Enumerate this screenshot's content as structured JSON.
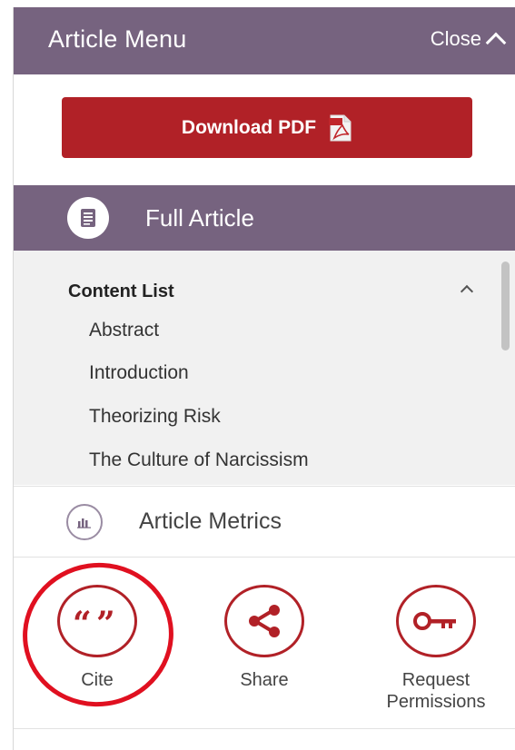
{
  "header": {
    "title": "Article Menu",
    "close_label": "Close"
  },
  "download": {
    "label": "Download PDF",
    "icon": "pdf-file-icon"
  },
  "full_article": {
    "label": "Full Article",
    "icon": "document-icon"
  },
  "content_list": {
    "title": "Content List",
    "items": [
      "Abstract",
      "Introduction",
      "Theorizing Risk",
      "The Culture of Narcissism"
    ]
  },
  "metrics": {
    "label": "Article Metrics",
    "icon": "bar-chart-icon"
  },
  "tools": [
    {
      "label": "Cite",
      "icon": "quote-icon"
    },
    {
      "label": "Share",
      "icon": "share-icon"
    },
    {
      "label": "Request Permissions",
      "icon": "key-icon"
    }
  ],
  "colors": {
    "header_bg": "#76637f",
    "accent_red": "#b12127",
    "highlight": "#e01020"
  }
}
